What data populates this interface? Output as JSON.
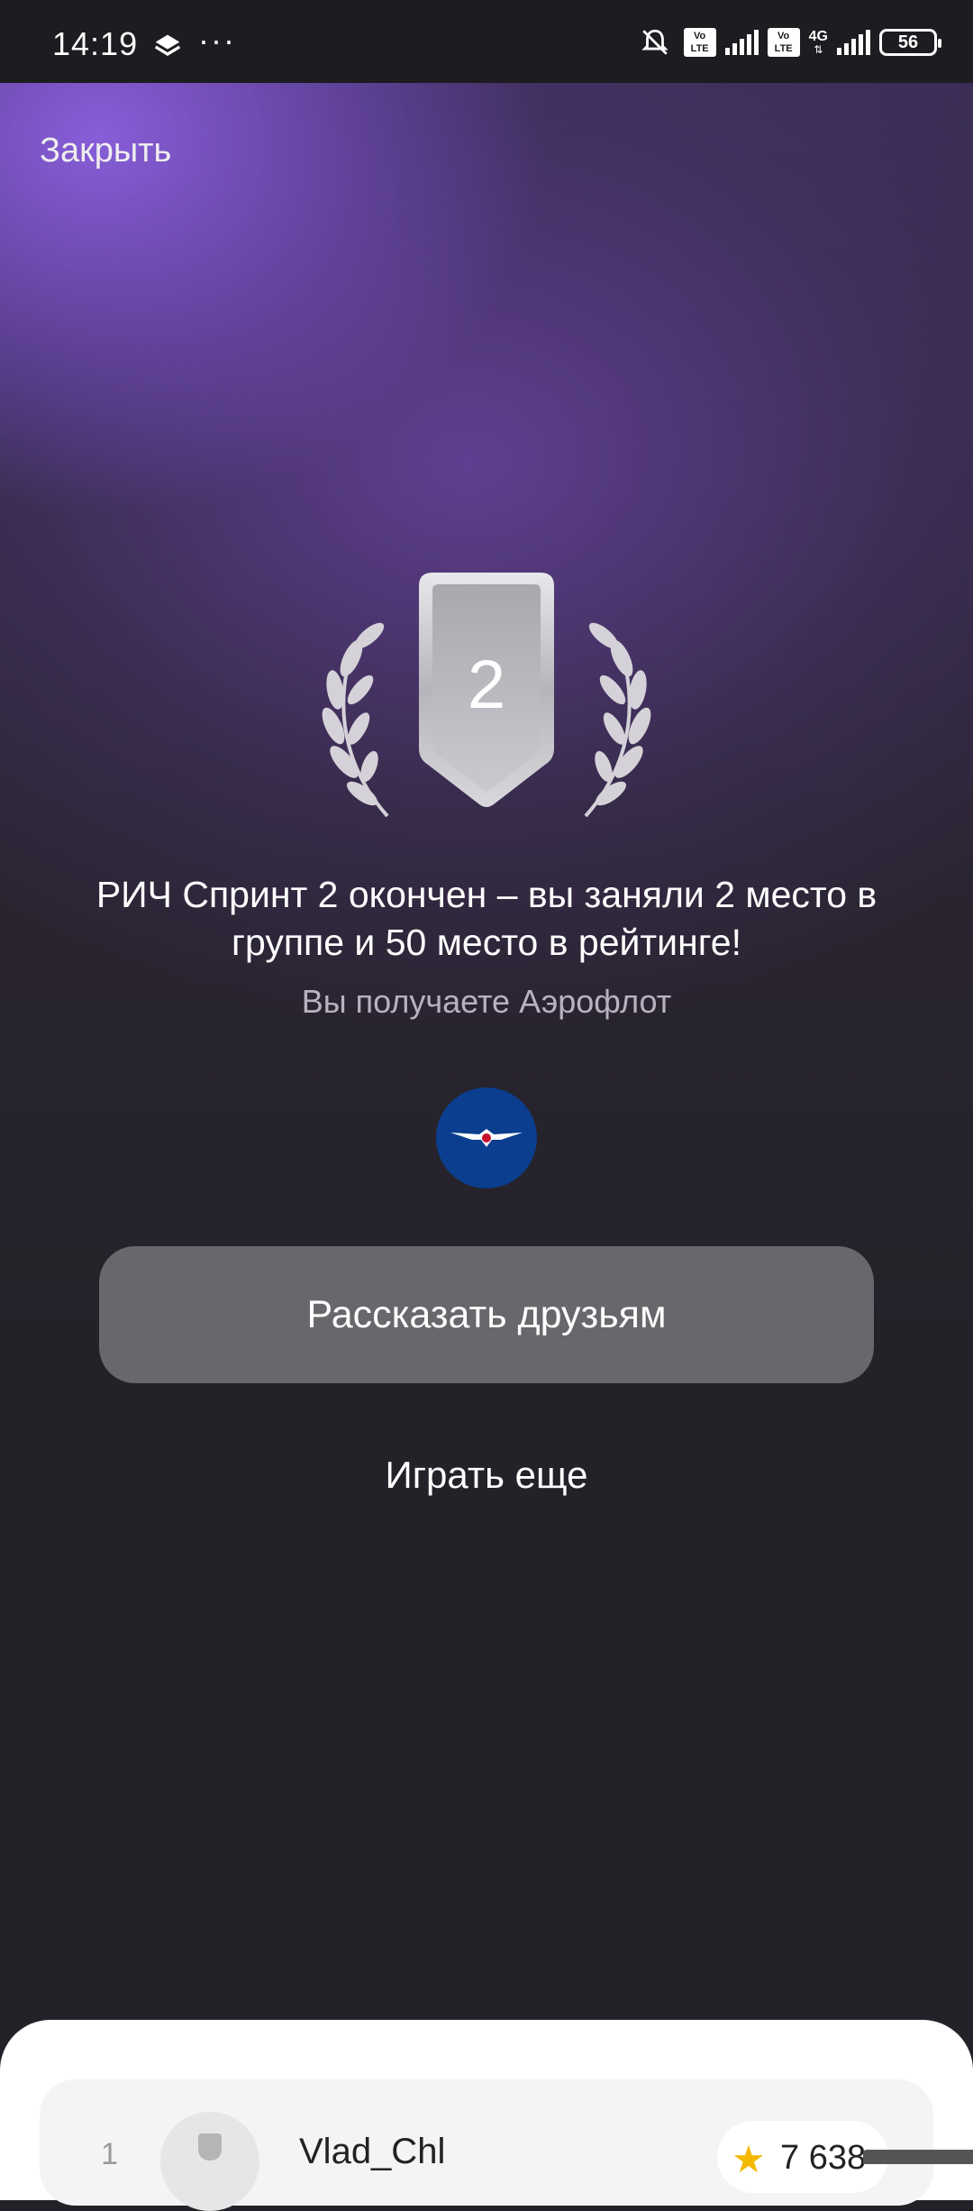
{
  "status_bar": {
    "time": "14:19",
    "dots": "···",
    "volte1": "Vo LTE",
    "volte2": "Vo LTE",
    "network": "4G",
    "battery": "56"
  },
  "header": {
    "close_label": "Закрыть"
  },
  "result": {
    "place_badge": "2",
    "headline": "РИЧ Спринт 2 окончен – вы заняли 2 место в группе и 50 место в рейтинге!",
    "reward_text": "Вы получаете Аэрофлот",
    "reward_logo_icon": "aeroflot-logo"
  },
  "actions": {
    "share_label": "Рассказать друзьям",
    "play_again_label": "Играть еще"
  },
  "leaderboard": {
    "rows": [
      {
        "rank": "1",
        "name": "Vlad_Chl",
        "score": "7 638"
      }
    ]
  },
  "colors": {
    "accent_purple": "#8c60e0",
    "button_gray": "#68676b",
    "background": "#232127",
    "aeroflot_blue": "#0b3e8e",
    "star": "#f5b800"
  }
}
